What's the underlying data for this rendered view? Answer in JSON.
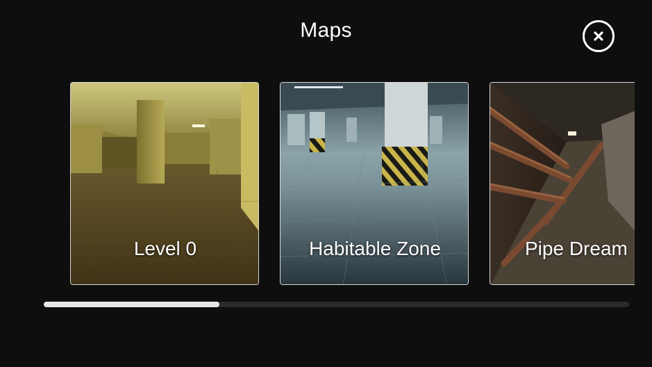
{
  "header": {
    "title": "Maps"
  },
  "close_button": {
    "icon": "close-icon"
  },
  "maps": [
    {
      "name": "Level 0"
    },
    {
      "name": "Habitable Zone"
    },
    {
      "name": "Pipe Dream"
    }
  ],
  "scrollbar": {
    "position_fraction": 0.3
  }
}
